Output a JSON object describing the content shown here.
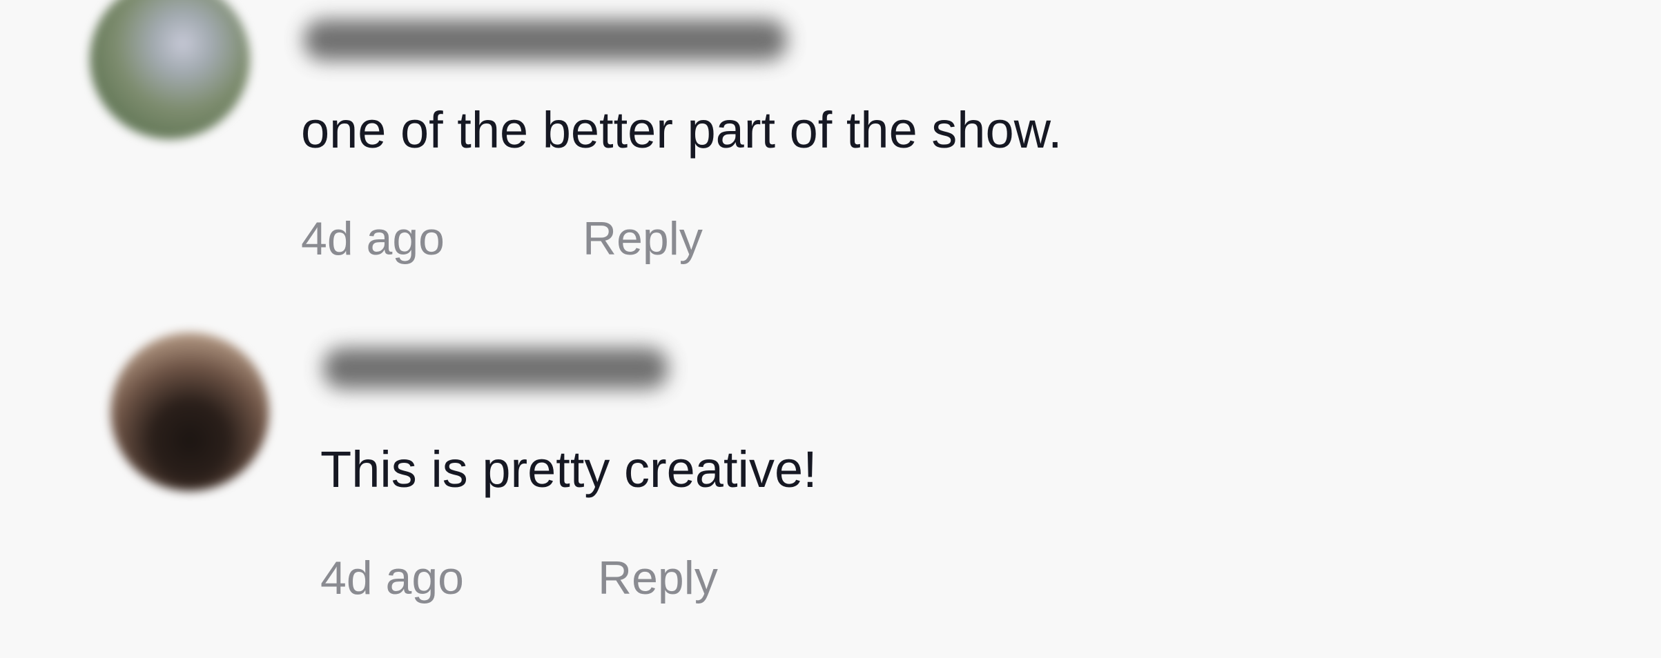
{
  "comments": [
    {
      "username": "",
      "text": "one of the better part of the show.",
      "timestamp": "4d ago",
      "reply_label": "Reply",
      "avatar_icon": "user-avatar-blurred"
    },
    {
      "username": "",
      "text": "This is pretty creative!",
      "timestamp": "4d ago",
      "reply_label": "Reply",
      "avatar_icon": "user-avatar-blurred"
    }
  ],
  "colors": {
    "background": "#f8f8f8",
    "comment_text": "#161823",
    "meta_text": "#8a8b91"
  }
}
